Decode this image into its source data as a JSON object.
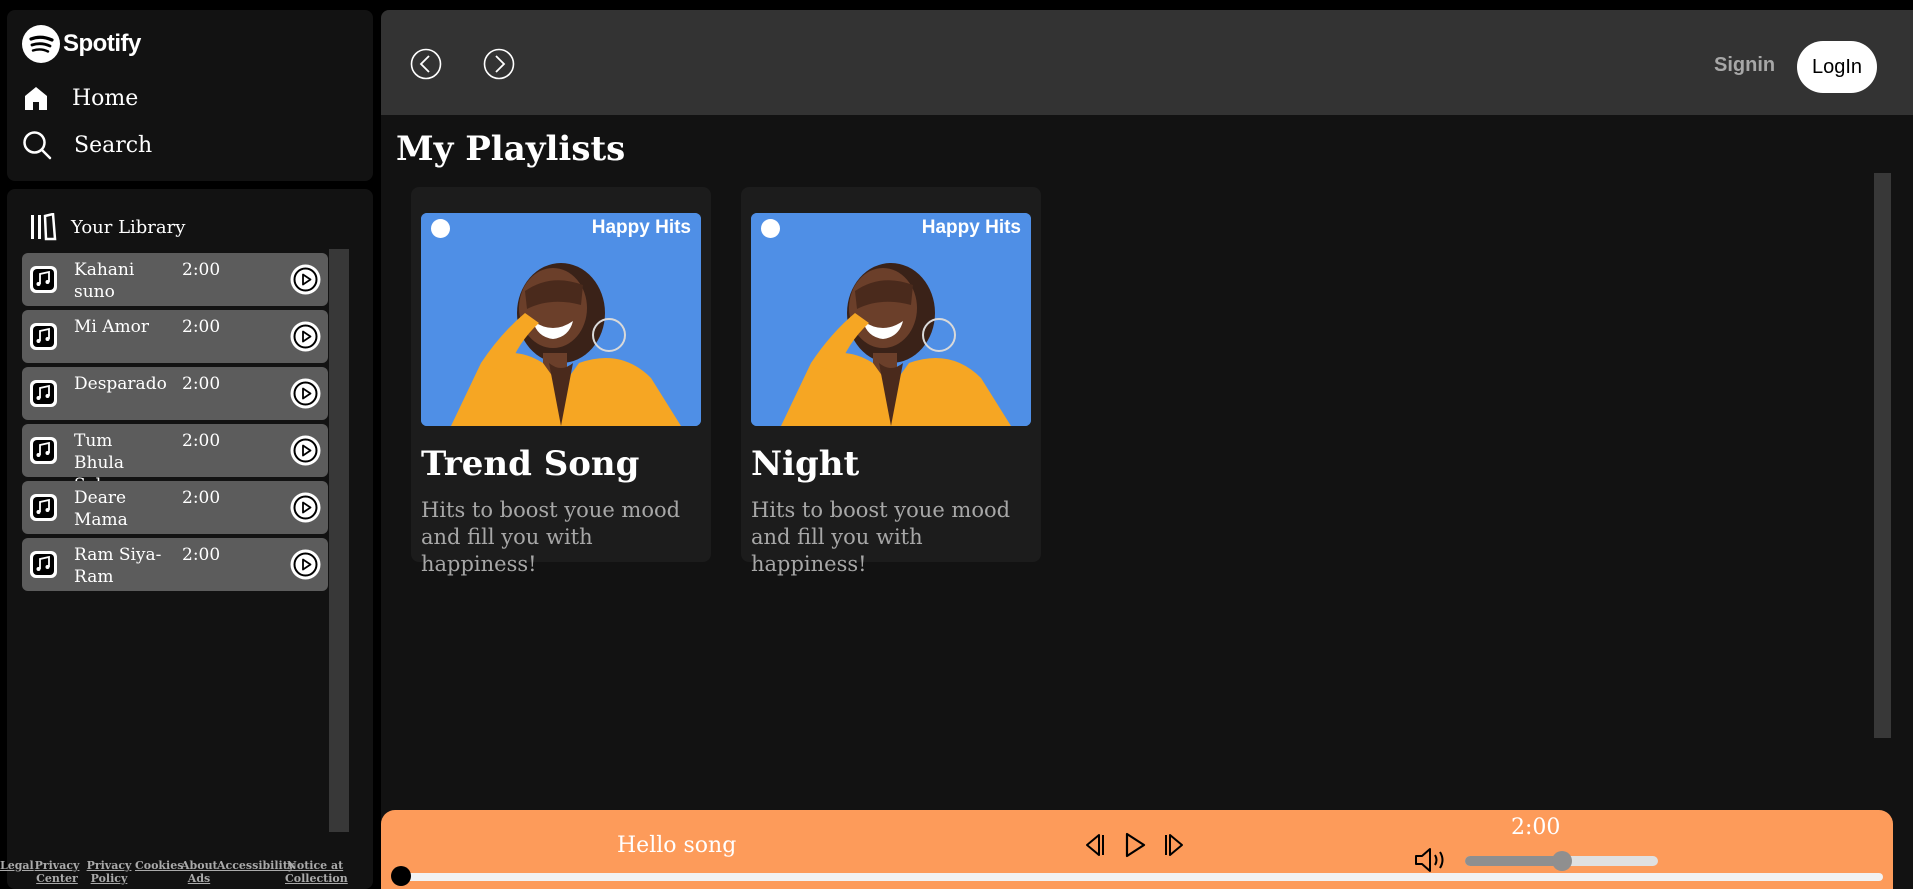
{
  "sidebar": {
    "brand": "Spotify",
    "home_label": "Home",
    "search_label": "Search"
  },
  "library": {
    "title": "Your Library",
    "songs": [
      {
        "name": "Kahani suno",
        "duration": "2:00"
      },
      {
        "name": "Mi Amor",
        "duration": "2:00"
      },
      {
        "name": "Desparado",
        "duration": "2:00"
      },
      {
        "name": "Tum Bhula Sako",
        "duration": "2:00"
      },
      {
        "name": "Deare Mama",
        "duration": "2:00"
      },
      {
        "name": "Ram Siya-Ram",
        "duration": "2:00"
      }
    ],
    "footer_links": [
      "Legal",
      "Privacy Center",
      "Privacy Policy",
      "Cookies",
      "About Ads",
      "Accessibility",
      "Notice at Collection"
    ]
  },
  "header": {
    "signin_label": "Signin",
    "login_label": "LogIn"
  },
  "main": {
    "section_title": "My Playlists",
    "cards": [
      {
        "cover_text": "Happy Hits",
        "title": "Trend Song",
        "description": "Hits to boost youe mood and fill you with happiness!"
      },
      {
        "cover_text": "Happy Hits",
        "title": "Night",
        "description": "Hits to boost youe mood and fill you with happiness!"
      }
    ]
  },
  "player": {
    "song_name": "Hello song",
    "time": "2:00",
    "volume_fraction": 0.5,
    "seek_fraction": 0.0
  },
  "colors": {
    "player_bg": "#fd9b5a",
    "panel_bg": "#121212",
    "topbar_bg": "#333333",
    "song_item_bg": "#5c5c5c",
    "cover_bg": "#4f8fe6"
  }
}
